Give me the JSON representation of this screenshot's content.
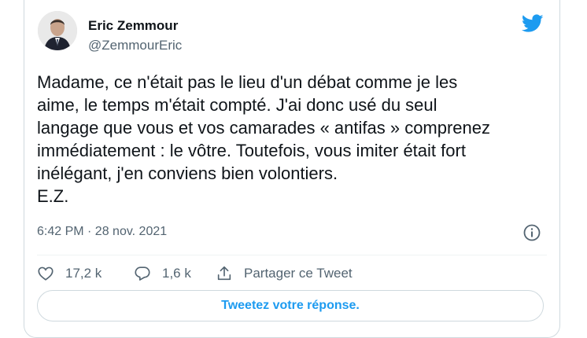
{
  "author": {
    "name": "Eric Zemmour",
    "handle": "@ZemmourEric",
    "avatar_icon": "profile-photo"
  },
  "tweet": {
    "text": "Madame, ce n'était pas le lieu d'un débat comme je les\naime, le temps m'était compté. J'ai donc usé du seul\nlangage que vous et vos camarades « antifas » comprenez\nimmédiatement : le vôtre. Toutefois, vous imiter était fort\ninélégant, j'en conviens bien volontiers.\nE.Z.",
    "timestamp": "6:42 PM · 28 nov. 2021"
  },
  "actions": {
    "like_count": "17,2 k",
    "reply_count": "1,6 k",
    "share_label": "Partager ce Tweet"
  },
  "reply_button": {
    "label": "Tweetez votre réponse."
  },
  "colors": {
    "brand": "#1d9bf0",
    "text": "#0f1419",
    "secondary": "#536471",
    "border": "#cfd9de"
  },
  "icons": {
    "logo": "twitter-bird-icon",
    "info": "info-icon",
    "like": "heart-icon",
    "reply": "reply-bubble-icon",
    "share": "share-icon"
  }
}
